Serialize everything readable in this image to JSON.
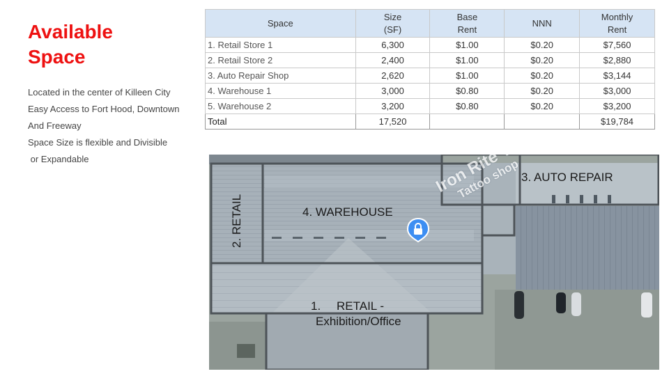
{
  "title": "Available Space",
  "bullets": [
    "Located in the center of Killeen City",
    "Easy Access to Fort Hood, Downtown",
    "And Freeway",
    "Space Size is flexible and Divisible",
    " or Expandable"
  ],
  "table": {
    "headers": {
      "space": "Space",
      "size_line1": "Size",
      "size_line2": "(SF)",
      "base_line1": "Base",
      "base_line2": "Rent",
      "nnn": "NNN",
      "monthly_line1": "Monthly",
      "monthly_line2": "Rent"
    },
    "rows": [
      {
        "space": "1. Retail Store 1",
        "size": "6,300",
        "base": "$1.00",
        "nnn": "$0.20",
        "monthly": "$7,560"
      },
      {
        "space": "2. Retail Store 2",
        "size": "2,400",
        "base": "$1.00",
        "nnn": "$0.20",
        "monthly": "$2,880"
      },
      {
        "space": "3. Auto Repair Shop",
        "size": "2,620",
        "base": "$1.00",
        "nnn": "$0.20",
        "monthly": "$3,144"
      },
      {
        "space": "4. Warehouse 1",
        "size": "3,000",
        "base": "$0.80",
        "nnn": "$0.20",
        "monthly": "$3,000"
      },
      {
        "space": "5. Warehouse 2",
        "size": "3,200",
        "base": "$0.80",
        "nnn": "$0.20",
        "monthly": "$3,200"
      }
    ],
    "total": {
      "label": "Total",
      "size": "17,520",
      "base": "",
      "nnn": "",
      "monthly": "$19,784"
    }
  },
  "map": {
    "label_retail2": "2. RETAIL",
    "label_warehouse": "4. WAREHOUSE",
    "label_auto": "3. AUTO REPAIR",
    "label_retail1_num": "1.",
    "label_retail1_line1": "RETAIL -",
    "label_retail1_line2": "Exhibition/Office",
    "watermark_line1": "Iron Rite Tattoo",
    "watermark_line2": "Tattoo shop",
    "pin_icon": "lock-pin-icon"
  }
}
